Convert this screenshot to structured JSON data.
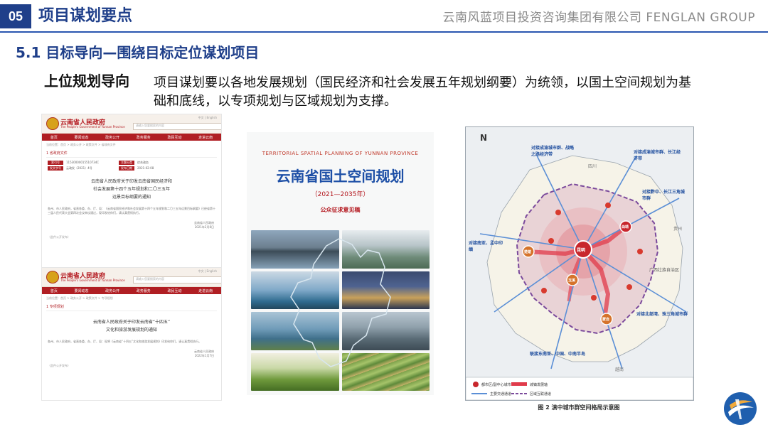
{
  "header": {
    "section_number": "05",
    "section_title": "项目谋划要点",
    "company": "云南风蓝项目投资咨询集团有限公司 FENGLAN GROUP"
  },
  "subtitle": "5.1 目标导向—围绕目标定位谋划项目",
  "label": "上位规划导向",
  "description": "项目谋划要以各地发展规划（国民经济和社会发展五年规划纲要）为统领，以国土空间规划为基础和底线，以专项规划与区域规划为支撑。",
  "doc1": {
    "brand": "云南省人民政府",
    "brand_en": "The People's Government of Yunnan Province",
    "top_links": "中文 | English",
    "search_placeholder": "请输入您要搜索的内容",
    "nav": [
      "首页",
      "要闻动态",
      "政务公开",
      "政务服务",
      "政民互动",
      "走进云南"
    ],
    "breadcrumb": "当前位置：首页 > 政务公开 > 政策文件 > 省政府文件",
    "tag": "1 省政府文件",
    "meta_keys": [
      "索引号",
      "发文字号",
      "主题分类",
      "发布日期"
    ],
    "meta_values": [
      "11530000015510734C",
      "云政发〔2021〕4号",
      "综合政务",
      "2021-02-08"
    ],
    "title_lines": [
      "云南省人民政府关于印发云南省国民经济和",
      "社会发展第十四个五年规划和二〇三五年",
      "远景目标纲要的通知"
    ],
    "body": "各州、市人民政府，省直各委、办、厅、局：《云南省国民经济和社会发展第十四个五年规划和二〇三五年远景目标纲要》已经省第十三届人民代表大会第四次会议审议通过，现印发给你们，请认真贯彻执行。",
    "sign": [
      "云南省人民政府",
      "2021年2月8日"
    ],
    "attach": "（此件公开发布）"
  },
  "doc2": {
    "brand": "云南省人民政府",
    "brand_en": "The People's Government of Yunnan Province",
    "top_links": "中文 | English",
    "search_placeholder": "请输入您要搜索的内容",
    "nav": [
      "首页",
      "要闻动态",
      "政务公开",
      "政务服务",
      "政民互动",
      "走进云南"
    ],
    "breadcrumb": "当前位置：首页 > 政务公开 > 政策文件 > 专项规划",
    "tag": "1 专项规划",
    "title_lines": [
      "云南省人民政府关于印发云南省“十四五”",
      "文化和旅游发展规划的通知"
    ],
    "body": "各州、市人民政府，省直各委、办、厅、局：现将《云南省“十四五”文化和旅游发展规划》印发给你们，请认真贯彻执行。",
    "sign": [
      "云南省人民政府",
      "2022年1月7日"
    ],
    "attach": "（此件公开发布）"
  },
  "cover": {
    "en_title": "TERRITORIAL SPATIAL PLANNING OF YUNNAN PROVINCE",
    "title": "云南省国土空间规划",
    "years": "（2021—2035年）",
    "note": "公众征求意见稿"
  },
  "map": {
    "north": "N",
    "caption": "图 2 滇中城市群空间格局示意图",
    "callouts": [
      "对接成渝城市群、战略之路经济带",
      "对接成渝城市群、长江经济带",
      "对接黔中、长江三角城市群",
      "对接南亚、孟中印缅",
      "广西壮族自治区",
      "对接北部湾、珠三角城市群",
      "联接东南亚、中国、中南半岛"
    ],
    "cities": [
      "昆明",
      "曲靖",
      "玉溪",
      "楚雄",
      "蒙自"
    ],
    "regions": [
      "四川",
      "贵州",
      "越南"
    ],
    "legend": [
      "都市区/副中心城市",
      "城镇发展轴",
      "主要交通通道",
      "区域互联通道"
    ]
  },
  "colors": {
    "brand_blue": "#1f3f8a",
    "gov_red": "#b01e23",
    "map_core": "#d8362b"
  }
}
